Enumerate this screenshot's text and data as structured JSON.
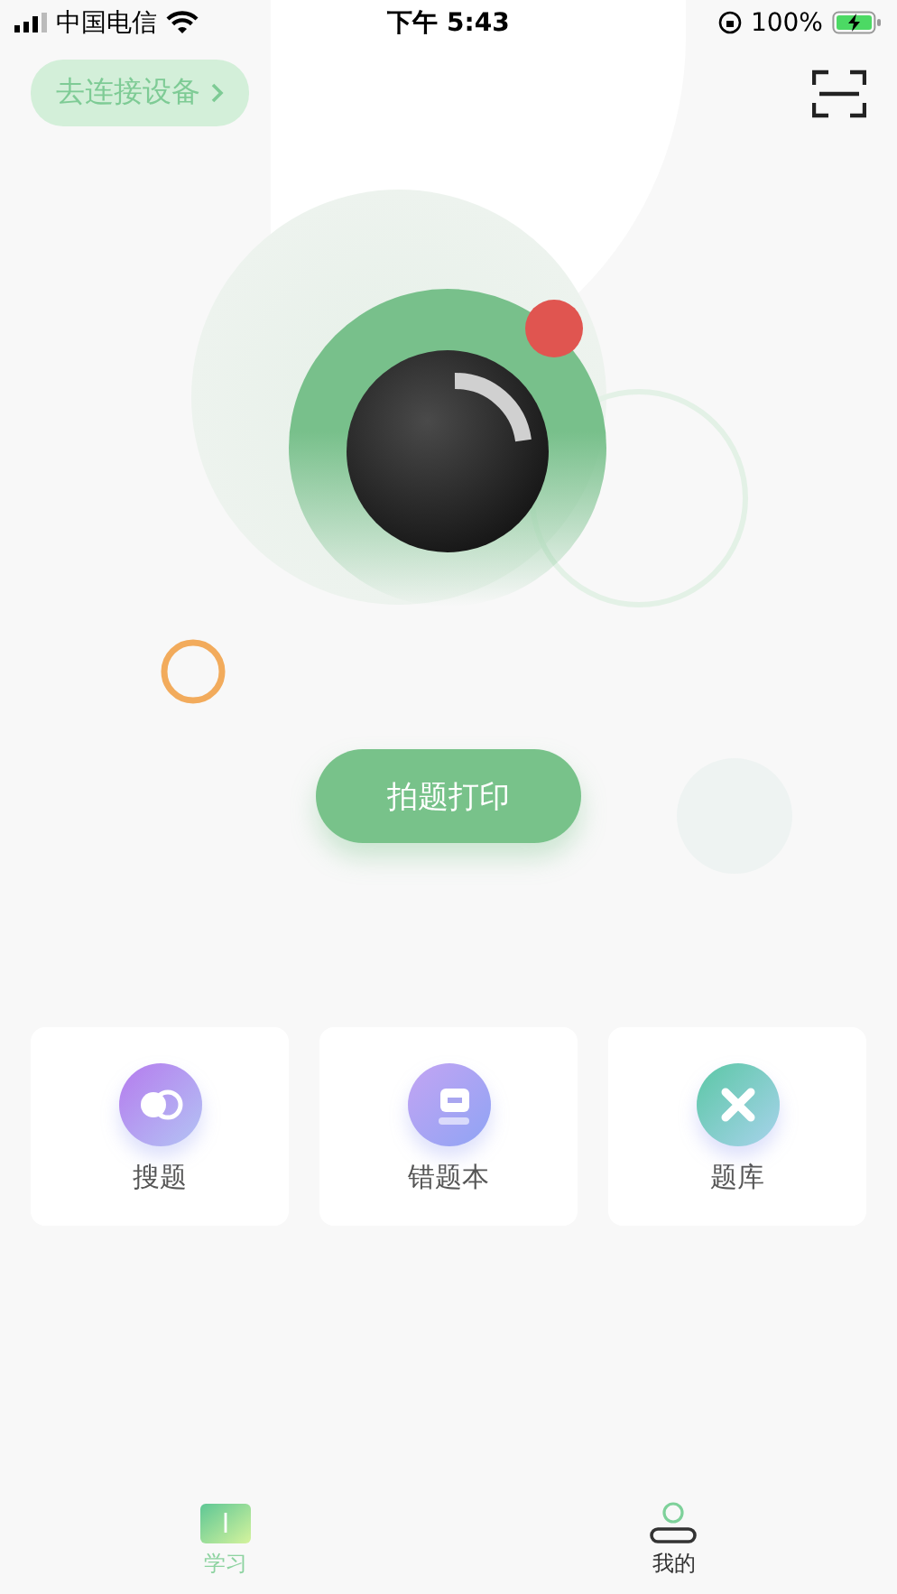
{
  "status_bar": {
    "carrier": "中国电信",
    "time": "下午 5:43",
    "battery": "100%"
  },
  "connect_button": {
    "label": "去连接设备"
  },
  "print_button": {
    "label": "拍题打印"
  },
  "features": [
    {
      "label": "搜题",
      "kind": "search"
    },
    {
      "label": "错题本",
      "kind": "notebook"
    },
    {
      "label": "题库",
      "kind": "bank"
    }
  ],
  "tabs": [
    {
      "label": "学习",
      "selected": true,
      "kind": "study"
    },
    {
      "label": "我的",
      "selected": false,
      "kind": "profile"
    }
  ]
}
